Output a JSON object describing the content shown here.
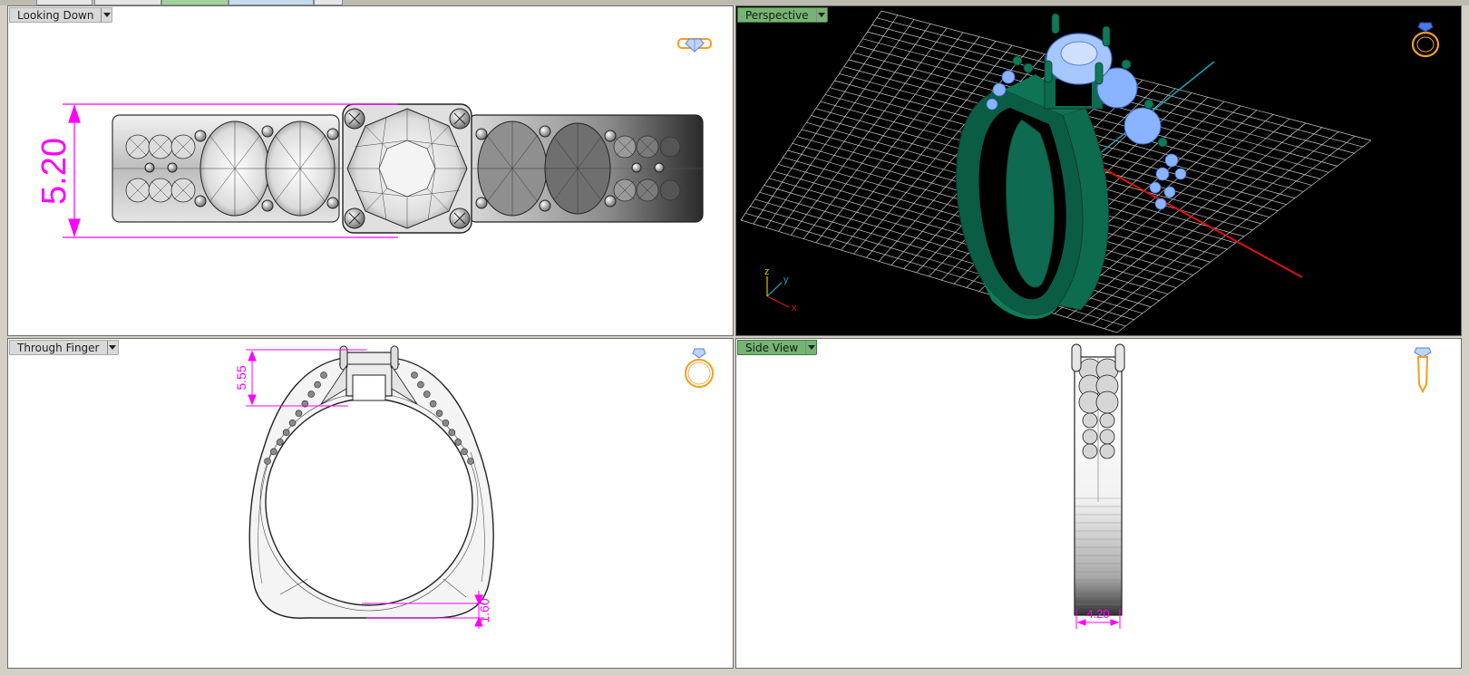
{
  "viewports": {
    "top_left": {
      "title": "Looking Down",
      "dimension": "5.20"
    },
    "top_right": {
      "title": "Perspective",
      "axes": {
        "x": "x",
        "y": "y",
        "z": "z"
      }
    },
    "bottom_left": {
      "title": "Through Finger",
      "dimension_top": "5.55",
      "dimension_bottom": "1.60"
    },
    "bottom_right": {
      "title": "Side View",
      "dimension": "4.20"
    }
  },
  "colors": {
    "dimension": "#ff00ff",
    "active_tab": "#77b374",
    "ring_metal_render": "#0d6b4f",
    "gem_render": "#8ab4ff",
    "nav_icon": "#f0a020",
    "grid": "#d0d0d0"
  },
  "icons": [
    "ring-top-view-icon",
    "ring-perspective-icon",
    "ring-front-view-icon",
    "ring-side-view-icon",
    "dropdown-arrow-icon"
  ]
}
